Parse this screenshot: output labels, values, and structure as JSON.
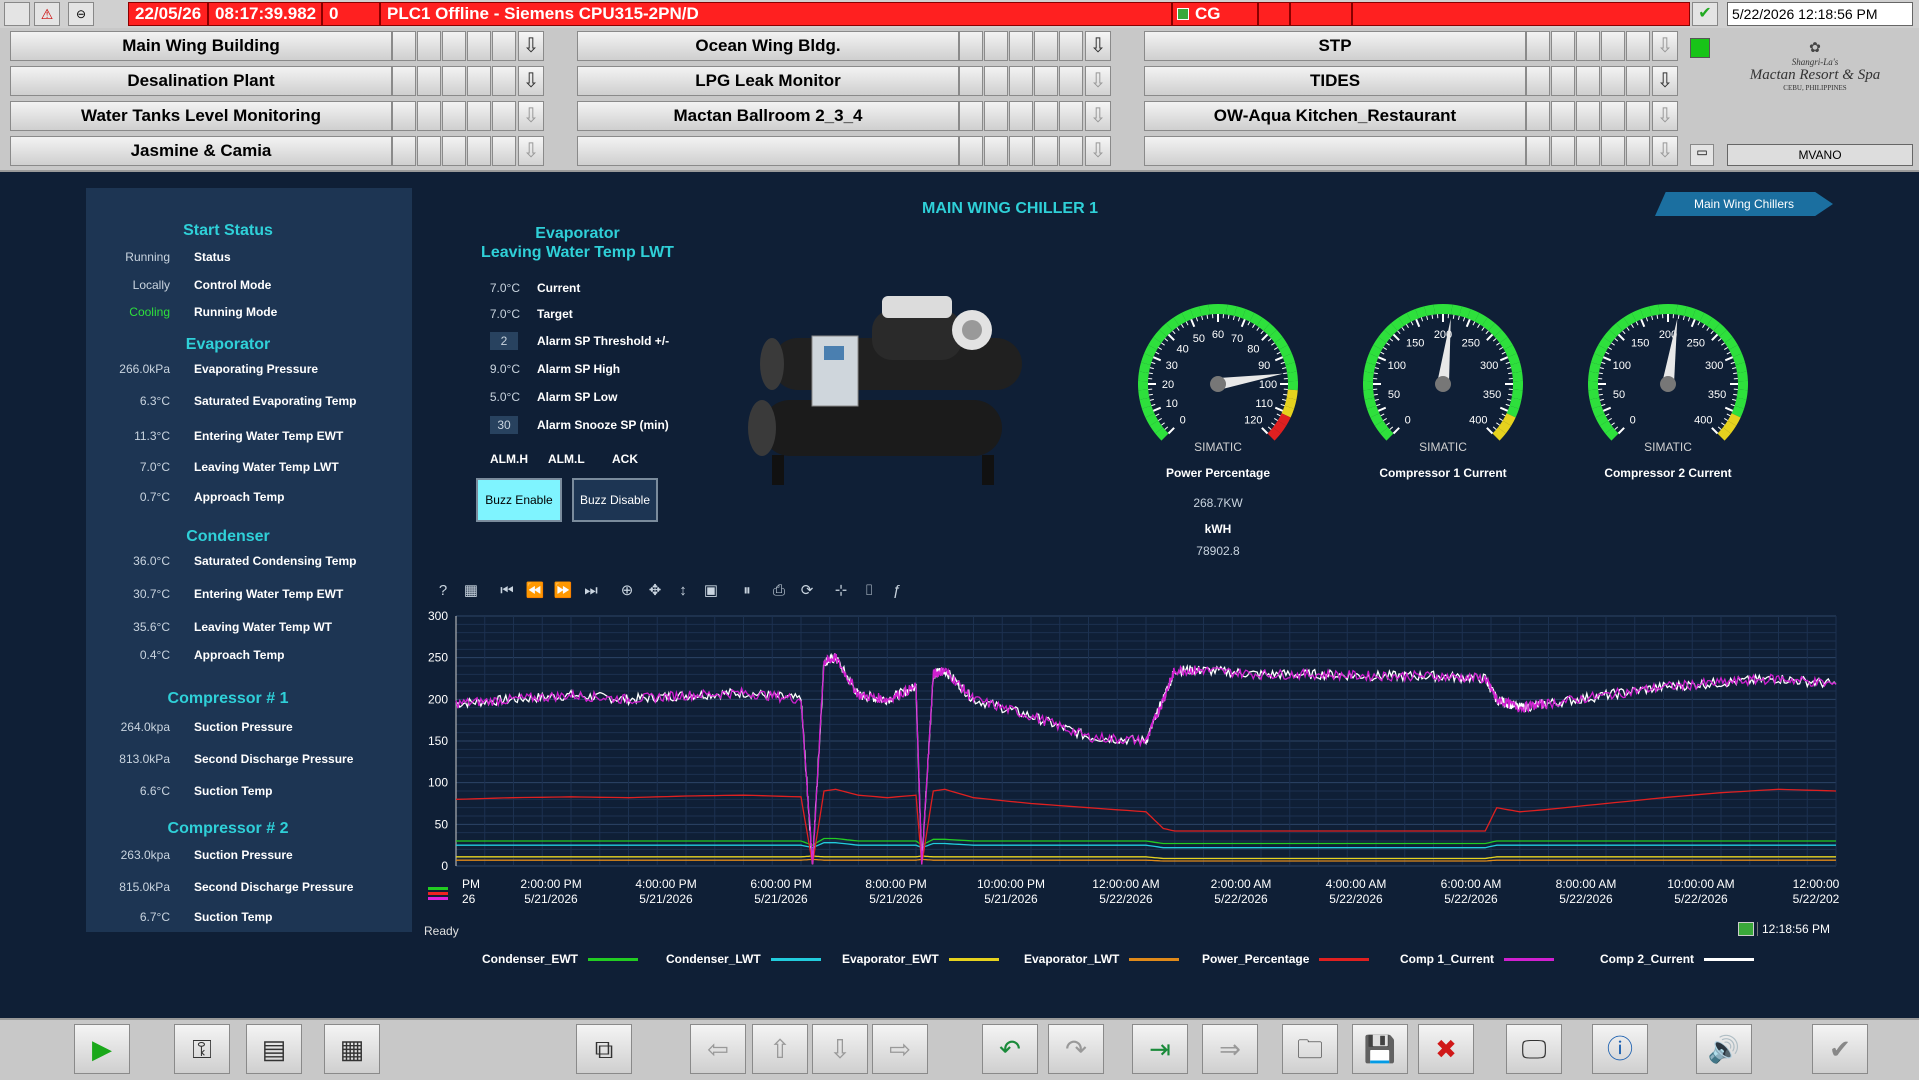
{
  "alarm_bar": {
    "date": "22/05/26",
    "time": "08:17:39.982",
    "count": "0",
    "message": "PLC1 Offline - Siemens CPU315-2PN/D",
    "code": "CG",
    "clock": "5/22/2026 12:18:56 PM"
  },
  "nav": {
    "buttons": [
      {
        "label": "Main Wing Building"
      },
      {
        "label": "Ocean Wing Bldg."
      },
      {
        "label": "STP"
      },
      {
        "label": "Desalination Plant"
      },
      {
        "label": "LPG Leak Monitor"
      },
      {
        "label": "TIDES"
      },
      {
        "label": "Water Tanks Level Monitoring"
      },
      {
        "label": "Mactan Ballroom 2_3_4"
      },
      {
        "label": "OW-Aqua Kitchen_Restaurant"
      },
      {
        "label": "Jasmine & Camia"
      },
      {
        "label": ""
      },
      {
        "label": ""
      }
    ],
    "logo_line1": "Shangri-La's",
    "logo_line2": "Mactan Resort & Spa",
    "logo_line3": "CEBU, PHILIPPINES",
    "user": "MVANO"
  },
  "page": {
    "title": "MAIN WING CHILLER 1",
    "tab": "Main Wing Chillers"
  },
  "left": {
    "start_status_title": "Start Status",
    "start_status": [
      {
        "value": "Running",
        "label": "Status"
      },
      {
        "value": "Locally",
        "label": "Control Mode"
      },
      {
        "value": "Cooling",
        "label": "Running Mode"
      }
    ],
    "evaporator_title": "Evaporator",
    "evaporator": [
      {
        "value": "266.0kPa",
        "label": "Evaporating Pressure"
      },
      {
        "value": "6.3°C",
        "label": "Saturated Evaporating Temp"
      },
      {
        "value": "11.3°C",
        "label": "Entering Water Temp EWT"
      },
      {
        "value": "7.0°C",
        "label": "Leaving Water Temp LWT"
      },
      {
        "value": "0.7°C",
        "label": "Approach Temp"
      }
    ],
    "condenser_title": "Condenser",
    "condenser": [
      {
        "value": "36.0°C",
        "label": "Saturated Condensing Temp"
      },
      {
        "value": "30.7°C",
        "label": "Entering Water Temp EWT"
      },
      {
        "value": "35.6°C",
        "label": "Leaving Water Temp WT"
      },
      {
        "value": "0.4°C",
        "label": "Approach Temp"
      }
    ],
    "comp1_title": "Compressor # 1",
    "comp1": [
      {
        "value": "264.0kpa",
        "label": "Suction Pressure"
      },
      {
        "value": "813.0kPa",
        "label": "Second Discharge Pressure"
      },
      {
        "value": "6.6°C",
        "label": "Suction Temp"
      }
    ],
    "comp2_title": "Compressor # 2",
    "comp2": [
      {
        "value": "263.0kpa",
        "label": "Suction Pressure"
      },
      {
        "value": "815.0kPa",
        "label": "Second Discharge Pressure"
      },
      {
        "value": "6.7°C",
        "label": "Suction Temp"
      }
    ]
  },
  "evap_lwt": {
    "title": "Evaporator\nLeaving Water Temp LWT",
    "rows": [
      {
        "value": "7.0°C",
        "label": "Current"
      },
      {
        "value": "7.0°C",
        "label": "Target"
      },
      {
        "value": "2",
        "label": "Alarm SP Threshold +/-",
        "boxed": true
      },
      {
        "value": "9.0°C",
        "label": "Alarm SP High"
      },
      {
        "value": "5.0°C",
        "label": "Alarm SP Low"
      },
      {
        "value": "30",
        "label": "Alarm Snooze SP (min)",
        "boxed": true
      }
    ],
    "alm_h": "ALM.H",
    "alm_l": "ALM.L",
    "ack": "ACK",
    "buzz_enable": "Buzz Enable",
    "buzz_disable": "Buzz Disable"
  },
  "gauges": [
    {
      "label": "Power Percentage",
      "brand": "SIMATIC",
      "min": 0,
      "max": 120,
      "value": 96,
      "ticks": [
        "0",
        "10",
        "20",
        "30",
        "40",
        "50",
        "60",
        "70",
        "80",
        "90",
        "100",
        "110",
        "120"
      ]
    },
    {
      "label": "Compressor 1 Current",
      "brand": "SIMATIC",
      "min": 0,
      "max": 400,
      "value": 210,
      "ticks": [
        "0",
        "50",
        "100",
        "150",
        "200",
        "250",
        "300",
        "350",
        "400"
      ]
    },
    {
      "label": "Compressor 2 Current",
      "brand": "SIMATIC",
      "min": 0,
      "max": 400,
      "value": 212,
      "ticks": [
        "0",
        "50",
        "100",
        "150",
        "200",
        "250",
        "300",
        "350",
        "400"
      ]
    }
  ],
  "power": {
    "kw": "268.7KW",
    "kwh_label": "kWH",
    "kwh": "78902.8"
  },
  "trend": {
    "status": "Ready",
    "time": "12:18:56 PM",
    "legend": [
      {
        "name": "Condenser_EWT",
        "color": "#22cc22"
      },
      {
        "name": "Condenser_LWT",
        "color": "#22ccdd"
      },
      {
        "name": "Evaporator_EWT",
        "color": "#e6d21e"
      },
      {
        "name": "Evaporator_LWT",
        "color": "#e08a1a"
      },
      {
        "name": "Power_Percentage",
        "color": "#e02020"
      },
      {
        "name": "Comp 1_Current",
        "color": "#d020d0"
      },
      {
        "name": "Comp 2_Current",
        "color": "#ffffff"
      }
    ]
  },
  "chart_data": {
    "type": "line",
    "ylim": [
      0,
      300
    ],
    "yticks": [
      0,
      50,
      100,
      150,
      200,
      250,
      300
    ],
    "xticks": [
      {
        "t": "PM",
        "d": "26"
      },
      {
        "t": "2:00:00 PM",
        "d": "5/21/2026"
      },
      {
        "t": "4:00:00 PM",
        "d": "5/21/2026"
      },
      {
        "t": "6:00:00 PM",
        "d": "5/21/2026"
      },
      {
        "t": "8:00:00 PM",
        "d": "5/21/2026"
      },
      {
        "t": "10:00:00 PM",
        "d": "5/21/2026"
      },
      {
        "t": "12:00:00 AM",
        "d": "5/22/2026"
      },
      {
        "t": "2:00:00 AM",
        "d": "5/22/2026"
      },
      {
        "t": "4:00:00 AM",
        "d": "5/22/2026"
      },
      {
        "t": "6:00:00 AM",
        "d": "5/22/2026"
      },
      {
        "t": "8:00:00 AM",
        "d": "5/22/2026"
      },
      {
        "t": "10:00:00 AM",
        "d": "5/22/2026"
      },
      {
        "t": "12:00:00",
        "d": "5/22/202"
      }
    ],
    "x_hours": [
      0,
      1,
      2,
      3,
      4,
      5,
      6,
      6.2,
      6.4,
      6.6,
      7,
      7.5,
      8,
      8.1,
      8.3,
      8.5,
      9,
      10,
      11,
      12,
      12.3,
      12.5,
      13,
      14,
      15,
      16,
      17,
      17.9,
      18.1,
      18.5,
      19,
      20,
      21,
      22,
      23,
      24
    ],
    "series": [
      {
        "name": "Comp 1_Current",
        "color": "#d020d0",
        "values": [
          195,
          200,
          205,
          200,
          205,
          208,
          200,
          2,
          245,
          250,
          205,
          200,
          215,
          2,
          230,
          235,
          200,
          180,
          155,
          150,
          200,
          235,
          235,
          230,
          230,
          228,
          228,
          225,
          200,
          190,
          195,
          205,
          215,
          220,
          225,
          218
        ]
      },
      {
        "name": "Comp 2_Current",
        "color": "#ffffff",
        "values": [
          195,
          200,
          205,
          200,
          205,
          208,
          200,
          2,
          245,
          250,
          205,
          200,
          215,
          2,
          230,
          235,
          200,
          180,
          155,
          150,
          200,
          235,
          235,
          230,
          230,
          228,
          228,
          225,
          200,
          190,
          195,
          205,
          215,
          220,
          225,
          218
        ]
      },
      {
        "name": "Power_Percentage",
        "color": "#e02020",
        "values": [
          80,
          82,
          83,
          82,
          84,
          85,
          83,
          2,
          90,
          92,
          85,
          82,
          85,
          2,
          90,
          92,
          82,
          75,
          70,
          65,
          45,
          42,
          42,
          42,
          42,
          42,
          42,
          42,
          70,
          65,
          68,
          75,
          82,
          88,
          92,
          90
        ]
      },
      {
        "name": "Condenser_LWT",
        "color": "#22ccdd",
        "values": [
          25,
          25,
          25,
          25,
          25,
          25,
          25,
          22,
          28,
          28,
          25,
          25,
          25,
          22,
          27,
          27,
          25,
          25,
          25,
          25,
          22,
          22,
          22,
          22,
          22,
          22,
          22,
          22,
          25,
          25,
          25,
          25,
          25,
          25,
          25,
          25
        ]
      },
      {
        "name": "Condenser_EWT",
        "color": "#22cc22",
        "values": [
          30,
          30,
          30,
          30,
          30,
          30,
          30,
          25,
          33,
          33,
          30,
          30,
          30,
          25,
          32,
          32,
          30,
          30,
          30,
          30,
          27,
          27,
          27,
          27,
          27,
          27,
          27,
          27,
          30,
          30,
          30,
          30,
          30,
          30,
          30,
          30
        ]
      },
      {
        "name": "Evaporator_EWT",
        "color": "#e6d21e",
        "values": [
          11,
          11,
          11,
          11,
          11,
          11,
          11,
          12,
          11,
          11,
          11,
          11,
          11,
          12,
          11,
          11,
          11,
          11,
          11,
          11,
          9,
          9,
          9,
          9,
          9,
          9,
          9,
          9,
          11,
          11,
          11,
          11,
          11,
          11,
          11,
          11
        ]
      },
      {
        "name": "Evaporator_LWT",
        "color": "#e08a1a",
        "values": [
          7,
          7,
          7,
          7,
          7,
          7,
          7,
          8,
          7,
          7,
          7,
          7,
          7,
          8,
          7,
          7,
          7,
          7,
          7,
          7,
          6,
          6,
          6,
          6,
          6,
          6,
          6,
          6,
          7,
          7,
          7,
          7,
          7,
          7,
          7,
          7
        ]
      }
    ]
  },
  "toolbar": {
    "icons": [
      "play-icon",
      "key-icon",
      "notepad-icon",
      "report-icon",
      "screen-load-icon",
      "left-arrow-icon",
      "up-arrow-icon",
      "down-arrow-icon",
      "right-arrow-icon",
      "undo-icon",
      "redo-icon",
      "import-icon",
      "export-icon",
      "folder-icon",
      "save-icon",
      "delete-icon",
      "monitor-icon",
      "info-icon",
      "sound-ack-icon",
      "exit-icon"
    ]
  }
}
